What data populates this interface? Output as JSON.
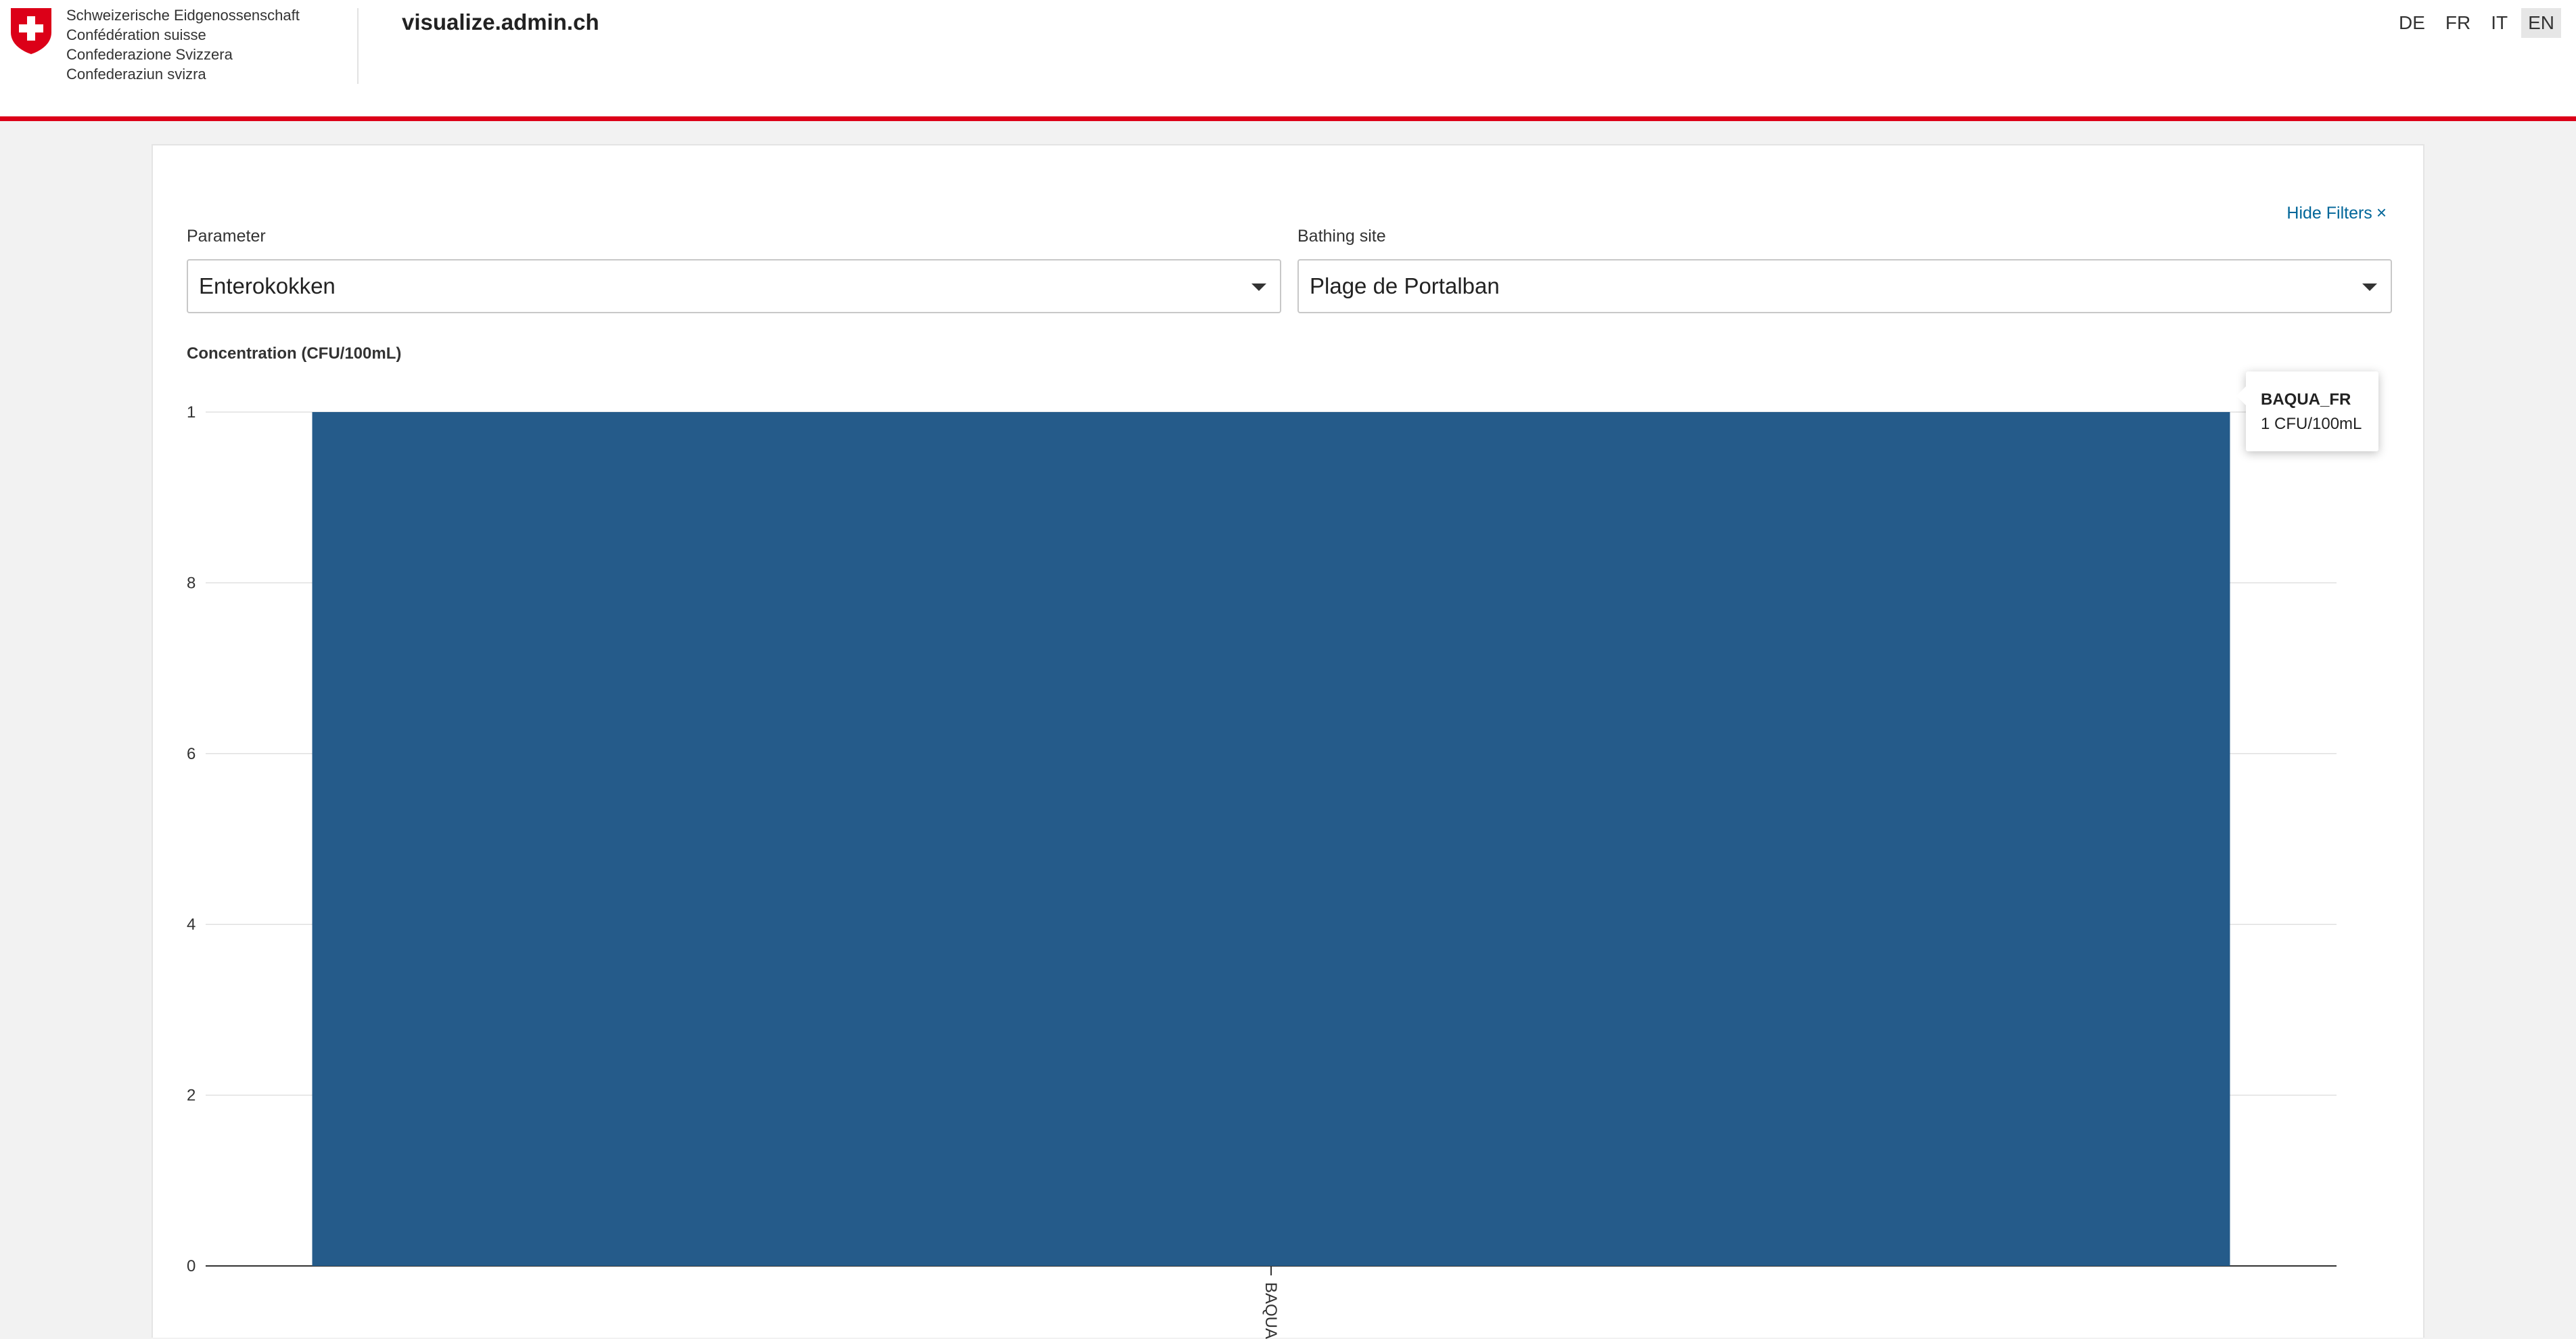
{
  "header": {
    "confederation_lines": [
      "Schweizerische Eidgenossenschaft",
      "Confédération suisse",
      "Confederazione Svizzera",
      "Confederaziun svizra"
    ],
    "site_title": "visualize.admin.ch",
    "languages": [
      "DE",
      "FR",
      "IT",
      "EN"
    ],
    "active_language": "EN",
    "logo_icon": "swiss-cross-shield-icon",
    "accent_color": "#dc0018"
  },
  "filters": {
    "hide_label": "Hide Filters",
    "hide_icon": "×",
    "parameter": {
      "label": "Parameter",
      "value": "Enterokokken"
    },
    "bathing_site": {
      "label": "Bathing site",
      "value": "Plage de Portalban"
    }
  },
  "tooltip": {
    "name": "BAQUA_FR",
    "value_text": "1 CFU/100mL"
  },
  "chart_data": {
    "type": "bar",
    "ylabel": "Concentration (CFU/100mL)",
    "categories": [
      "BAQUA_FR"
    ],
    "category_label_visible": "BAQUA",
    "values": [
      1
    ],
    "y_ticks": [
      {
        "value": 0,
        "label": "0"
      },
      {
        "value": 0.2,
        "label": "2"
      },
      {
        "value": 0.4,
        "label": "4"
      },
      {
        "value": 0.6,
        "label": "6"
      },
      {
        "value": 0.8,
        "label": "8"
      },
      {
        "value": 1,
        "label": "1"
      }
    ],
    "ylim": [
      0,
      1
    ],
    "grid": true,
    "bar_color": "#255b8a"
  }
}
